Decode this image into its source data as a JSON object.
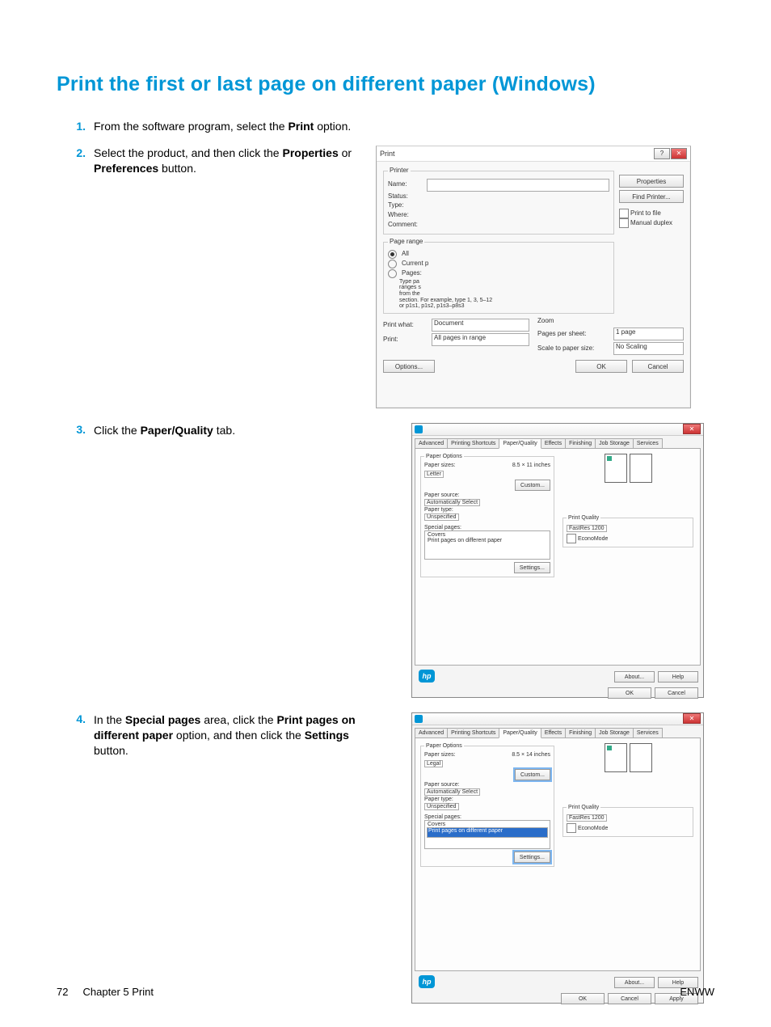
{
  "heading": "Print the first or last page on different paper (Windows)",
  "steps": {
    "s1_num": "1.",
    "s1_a": "From the software program, select the ",
    "s1_b": "Print",
    "s1_c": " option.",
    "s2_num": "2.",
    "s2_a": "Select the product, and then click the ",
    "s2_b": "Properties",
    "s2_c": " or ",
    "s2_d": "Preferences",
    "s2_e": " button.",
    "s3_num": "3.",
    "s3_a": "Click the ",
    "s3_b": "Paper/Quality",
    "s3_c": " tab.",
    "s4_num": "4.",
    "s4_a": "In the ",
    "s4_b": "Special pages",
    "s4_c": " area, click the ",
    "s4_d": "Print pages on different paper",
    "s4_e": " option, and then click the ",
    "s4_f": "Settings",
    "s4_g": " button."
  },
  "print_dialog": {
    "title": "Print",
    "printer_legend": "Printer",
    "name": "Name:",
    "status": "Status:",
    "type": "Type:",
    "where": "Where:",
    "comment": "Comment:",
    "btn_properties": "Properties",
    "btn_find": "Find Printer...",
    "chk_printfile": "Print to file",
    "chk_manual": "Manual duplex",
    "pagerange_legend": "Page range",
    "opt_all": "All",
    "opt_current": "Current p",
    "opt_pages": "Pages:",
    "typepages_a": "Type pa",
    "typepages_b": "ranges s",
    "typepages_c": "from the",
    "typepages_d": "section. For example, type 1, 3, 5–12",
    "typepages_e": "or p1s1, p1s2, p1s3–p8s3",
    "printwhat_l": "Print what:",
    "printwhat_v": "Document",
    "print_l": "Print:",
    "print_v": "All pages in range",
    "zoom": "Zoom",
    "pps_l": "Pages per sheet:",
    "pps_v": "1 page",
    "stps_l": "Scale to paper size:",
    "stps_v": "No Scaling",
    "options": "Options...",
    "ok": "OK",
    "cancel": "Cancel"
  },
  "prop_dialog": {
    "tabs": [
      "Advanced",
      "Printing Shortcuts",
      "Paper/Quality",
      "Effects",
      "Finishing",
      "Job Storage",
      "Services"
    ],
    "paperoptions": "Paper Options",
    "papersizes": "Paper sizes:",
    "papersize_dim_letter": "8.5 × 11 inches",
    "papersize_dim_legal": "8.5 × 14 inches",
    "papersize_letter": "Letter",
    "papersize_legal": "Legal",
    "custom": "Custom...",
    "papersource": "Paper source:",
    "papersource_v": "Automatically Select",
    "papertype": "Paper type:",
    "papertype_v": "Unspecified",
    "specialpages": "Special pages:",
    "sp_covers": "Covers",
    "sp_diff": "Print pages on different paper",
    "settings": "Settings...",
    "printquality": "Print Quality",
    "pq_v": "FastRes 1200",
    "econo": "EconoMode",
    "about": "About...",
    "help": "Help",
    "ok": "OK",
    "cancel": "Cancel",
    "apply": "Apply",
    "hp": "hp"
  },
  "footer": {
    "page": "72",
    "chapter": "Chapter 5   Print",
    "brand": "ENWW"
  }
}
